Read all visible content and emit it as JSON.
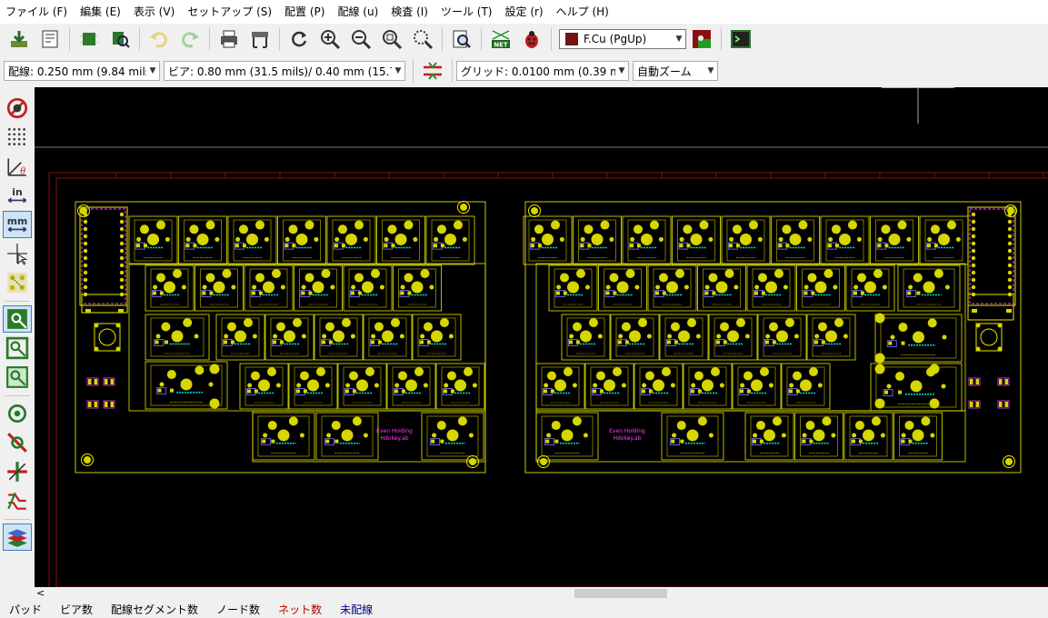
{
  "menu": [
    "ファイル (F)",
    "編集 (E)",
    "表示 (V)",
    "セットアップ (S)",
    "配置 (P)",
    "配線 (u)",
    "検査 (I)",
    "ツール (T)",
    "設定 (r)",
    "ヘルプ (H)"
  ],
  "layer_selector": {
    "value": "F.Cu (PgUp)",
    "swatch_color": "#7a1010"
  },
  "track_width": "配線: 0.250 mm (9.84 mils) *",
  "via_size": "ビア: 0.80 mm (31.5 mils)/ 0.40 mm (15.7 mils) *",
  "grid": "グリッド: 0.0100 mm (0.39 mils)",
  "zoom": "自動ズーム",
  "status": [
    {
      "label": "パッド",
      "color": "#000000"
    },
    {
      "label": "ビア数",
      "color": "#000000"
    },
    {
      "label": "配線セグメント数",
      "color": "#000000"
    },
    {
      "label": "ノード数",
      "color": "#000000"
    },
    {
      "label": "ネット数",
      "color": "#b00000"
    },
    {
      "label": "未配線",
      "color": "#000080"
    }
  ],
  "toolbar_icons": [
    "load-board-icon",
    "page-settings-icon",
    "footprint-editor-icon",
    "footprint-browser-icon",
    "undo-icon",
    "redo-icon",
    "print-icon",
    "plot-icon",
    "redraw-icon",
    "zoom-in-icon",
    "zoom-out-icon",
    "zoom-fit-icon",
    "zoom-selection-icon",
    "find-icon",
    "netlist-icon",
    "drc-icon",
    "layer-pair-icon",
    "scripting-console-icon"
  ],
  "left_icons": [
    "drc-toggle-icon",
    "grid-toggle-icon",
    "polar-coords-icon",
    "inch-units-icon",
    "mm-units-icon",
    "cursor-shape-icon",
    "ratsnest-icon",
    "zone-fill-icon",
    "zone-outline-icon",
    "zone-sketch-icon",
    "pad-sketch-icon",
    "via-sketch-icon",
    "track-sketch-icon",
    "microwave-icon",
    "layers-manager-icon"
  ],
  "left_group": {
    "label_left": "Even Holding",
    "label_right": "Even Holding",
    "sub": "Hdokey.ab"
  },
  "colors": {
    "pad": "#d6d600",
    "silk": "#e8e800",
    "fab": "#00e0e0",
    "courtyard": "#ff40ff",
    "edge": "#c8c800",
    "page_frame": "#8a1010",
    "mask": "#6060d0"
  }
}
